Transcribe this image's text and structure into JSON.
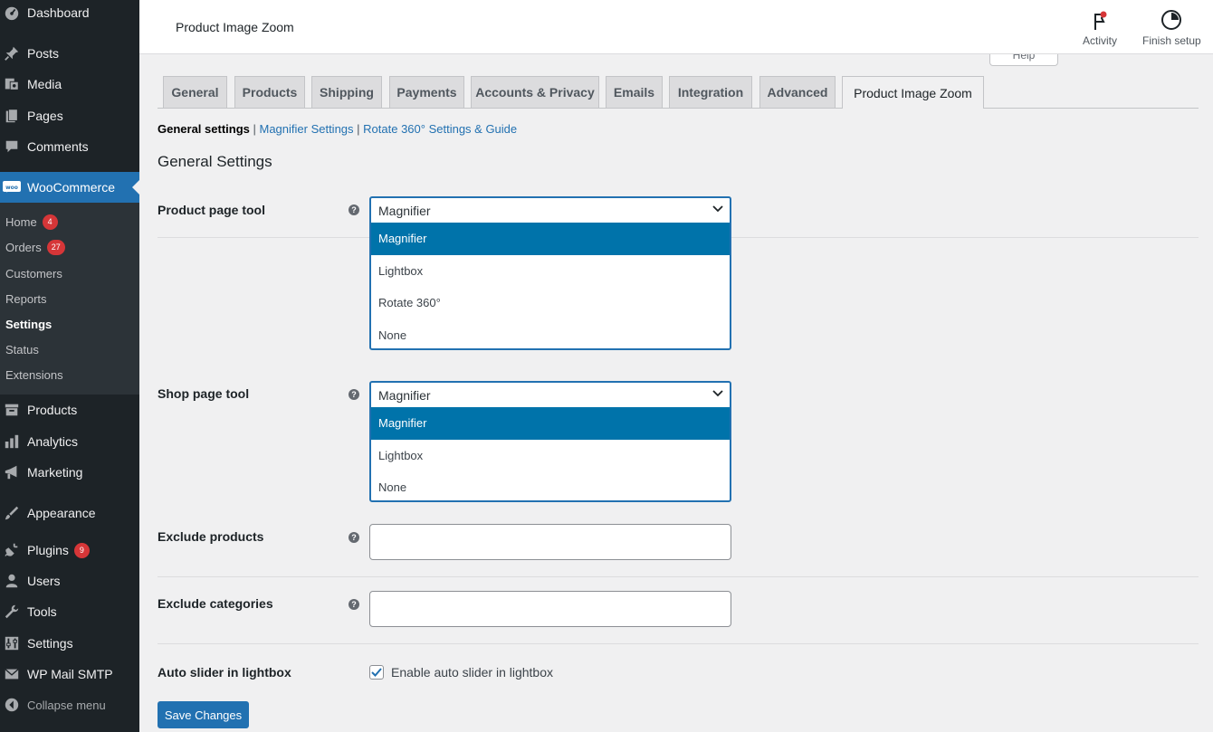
{
  "sidebar": {
    "items": [
      {
        "label": "Dashboard",
        "icon": "dashboard-icon"
      },
      {
        "label": "Posts",
        "icon": "pin-icon"
      },
      {
        "label": "Media",
        "icon": "media-icon"
      },
      {
        "label": "Pages",
        "icon": "pages-icon"
      },
      {
        "label": "Comments",
        "icon": "comment-icon"
      },
      {
        "label": "WooCommerce",
        "icon": "woo-icon"
      },
      {
        "label": "Products",
        "icon": "archive-icon"
      },
      {
        "label": "Analytics",
        "icon": "bar-chart-icon"
      },
      {
        "label": "Marketing",
        "icon": "megaphone-icon"
      },
      {
        "label": "Appearance",
        "icon": "brush-icon"
      },
      {
        "label": "Plugins",
        "icon": "plugin-icon",
        "badge": "9"
      },
      {
        "label": "Users",
        "icon": "user-icon"
      },
      {
        "label": "Tools",
        "icon": "wrench-icon"
      },
      {
        "label": "Settings",
        "icon": "sliders-icon"
      },
      {
        "label": "WP Mail SMTP",
        "icon": "mail-icon"
      },
      {
        "label": "Collapse menu",
        "icon": "collapse-icon"
      }
    ],
    "submenu": [
      {
        "label": "Home",
        "badge": "4"
      },
      {
        "label": "Orders",
        "badge": "27"
      },
      {
        "label": "Customers"
      },
      {
        "label": "Reports"
      },
      {
        "label": "Settings"
      },
      {
        "label": "Status"
      },
      {
        "label": "Extensions"
      }
    ]
  },
  "header": {
    "title": "Product Image Zoom",
    "activity_label": "Activity",
    "finish_setup_label": "Finish setup",
    "help_label": "Help"
  },
  "tabs": [
    {
      "label": "General"
    },
    {
      "label": "Products"
    },
    {
      "label": "Shipping"
    },
    {
      "label": "Payments"
    },
    {
      "label": "Accounts & Privacy"
    },
    {
      "label": "Emails"
    },
    {
      "label": "Integration"
    },
    {
      "label": "Advanced"
    },
    {
      "label": "Product Image Zoom"
    }
  ],
  "subnav": {
    "current": "General settings",
    "sep1": " | ",
    "link1": "Magnifier Settings",
    "sep2": " | ",
    "link2": "Rotate 360° Settings & Guide"
  },
  "section_title": "General Settings",
  "fields": {
    "product_page_tool": {
      "label": "Product page tool",
      "value": "Magnifier",
      "options": [
        "Magnifier",
        "Lightbox",
        "Rotate 360°",
        "None"
      ]
    },
    "shop_page_tool": {
      "label": "Shop page tool",
      "value": "Magnifier",
      "options": [
        "Magnifier",
        "Lightbox",
        "None"
      ]
    },
    "exclude_products": {
      "label": "Exclude products",
      "value": ""
    },
    "exclude_categories": {
      "label": "Exclude categories",
      "value": ""
    },
    "auto_slider": {
      "label": "Auto slider in lightbox",
      "checkbox_label": "Enable auto slider in lightbox",
      "checked": true
    }
  },
  "help_glyph": "?",
  "save_label": "Save Changes",
  "colors": {
    "sidebar_bg": "#1d2327",
    "accent": "#2271b1",
    "badge": "#d63638"
  }
}
